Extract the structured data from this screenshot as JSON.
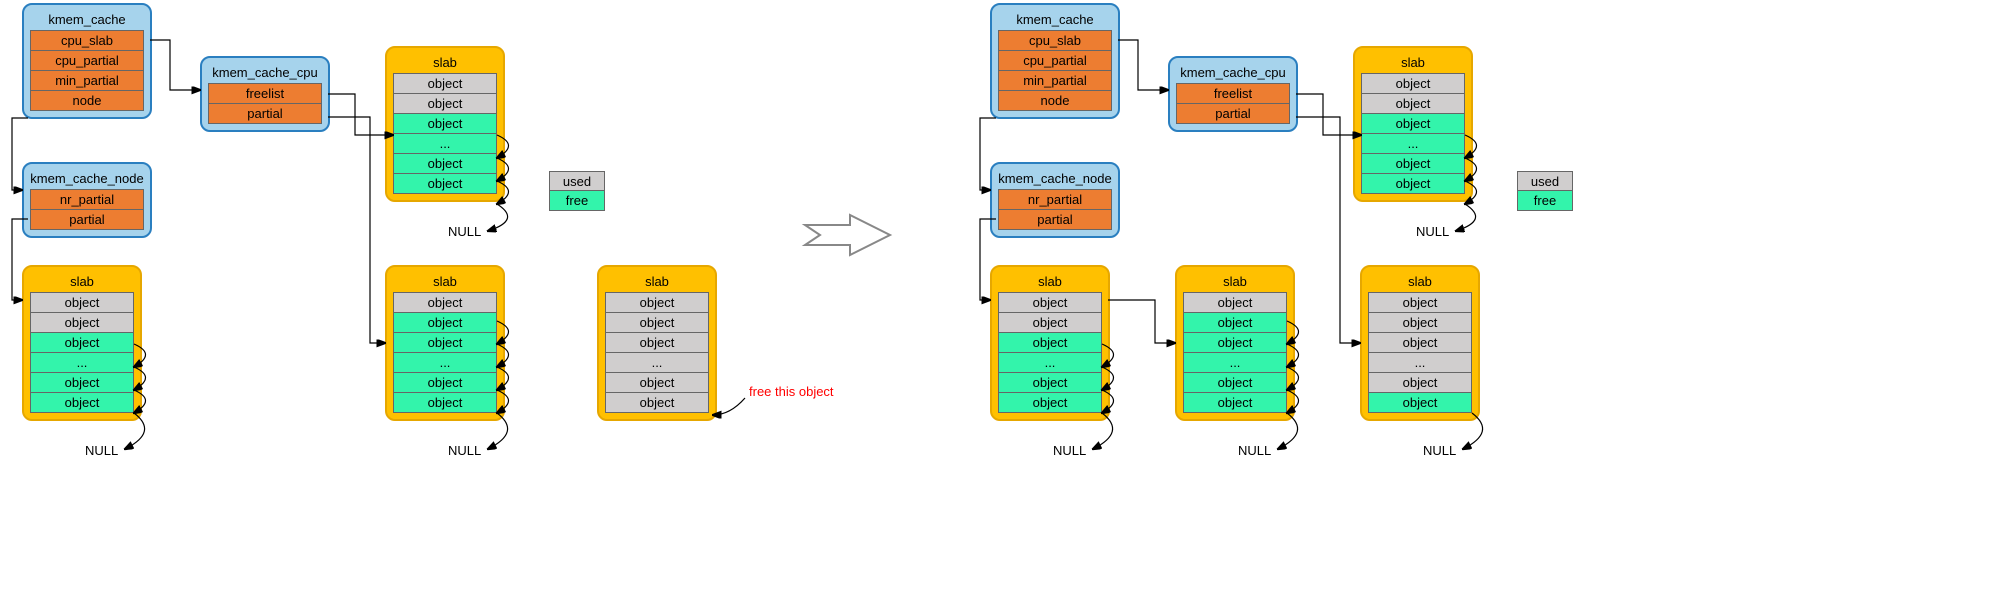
{
  "labels": {
    "kmem_cache": "kmem_cache",
    "kmem_cache_cpu": "kmem_cache_cpu",
    "kmem_cache_node": "kmem_cache_node",
    "slab": "slab",
    "cpu_slab": "cpu_slab",
    "cpu_partial": "cpu_partial",
    "min_partial": "min_partial",
    "node": "node",
    "freelist": "freelist",
    "partial": "partial",
    "nr_partial": "nr_partial",
    "object": "object",
    "dots": "...",
    "null": "NULL",
    "used": "used",
    "free": "free",
    "free_this": "free this object"
  },
  "colors": {
    "blue_bg": "#a6d3ec",
    "blue_border": "#2a7fc0",
    "yellow_bg": "#ffc000",
    "yellow_border": "#e6a700",
    "orange": "#ed7d31",
    "grey": "#d0cece",
    "green": "#33f4ab",
    "red": "#ff0000"
  }
}
